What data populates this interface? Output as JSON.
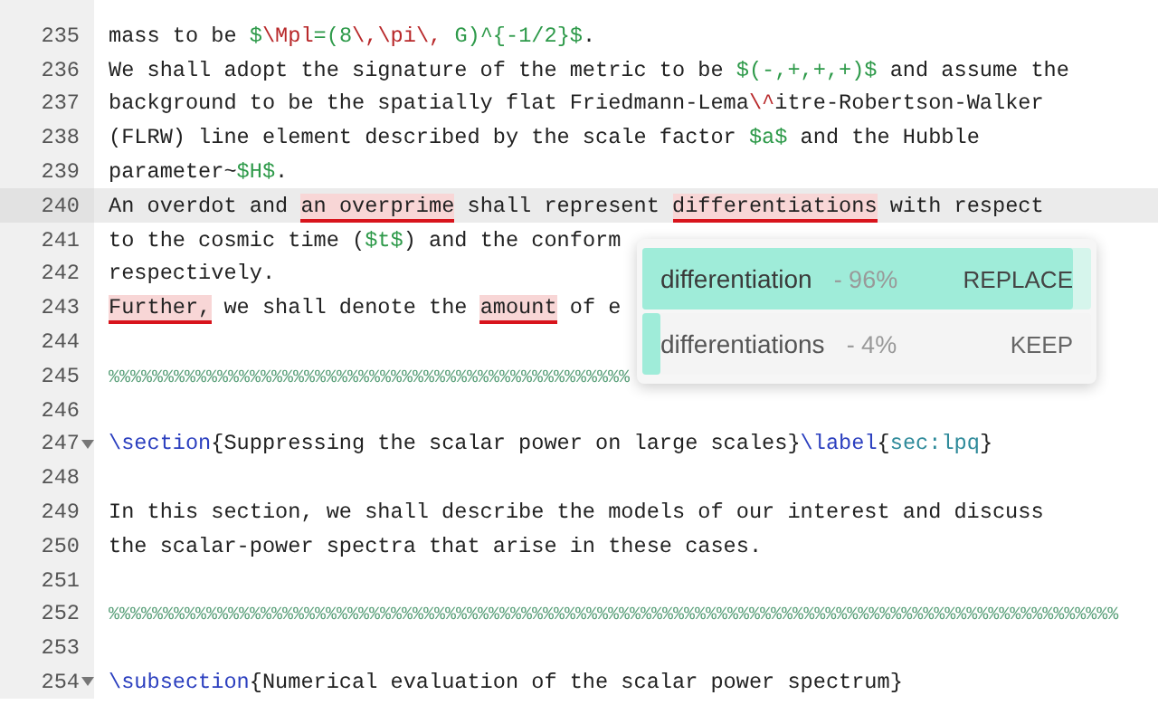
{
  "editor": {
    "lines": [
      {
        "number": "235",
        "current": false,
        "foldable": false,
        "segments": [
          {
            "kind": "plain",
            "text": "mass to be "
          },
          {
            "kind": "math",
            "text": "$"
          },
          {
            "kind": "mathcmd",
            "text": "\\Mpl"
          },
          {
            "kind": "math",
            "text": "=(8"
          },
          {
            "kind": "mathcmd",
            "text": "\\,\\pi\\,"
          },
          {
            "kind": "math",
            "text": " G)^{-1/2}$"
          },
          {
            "kind": "plain",
            "text": "."
          }
        ]
      },
      {
        "number": "236",
        "current": false,
        "foldable": false,
        "segments": [
          {
            "kind": "plain",
            "text": "We shall adopt the signature of the metric to be "
          },
          {
            "kind": "math",
            "text": "$(-,+,+,+)$"
          },
          {
            "kind": "plain",
            "text": " and assume the"
          }
        ]
      },
      {
        "number": "237",
        "current": false,
        "foldable": false,
        "segments": [
          {
            "kind": "plain",
            "text": "background to be the spatially flat Friedmann-Lema"
          },
          {
            "kind": "mathcmd",
            "text": "\\^"
          },
          {
            "kind": "plain",
            "text": "itre-Robertson-Walker"
          }
        ]
      },
      {
        "number": "238",
        "current": false,
        "foldable": false,
        "segments": [
          {
            "kind": "plain",
            "text": "(FLRW) line element described by the scale factor "
          },
          {
            "kind": "math",
            "text": "$a$"
          },
          {
            "kind": "plain",
            "text": " and the Hubble"
          }
        ]
      },
      {
        "number": "239",
        "current": false,
        "foldable": false,
        "segments": [
          {
            "kind": "plain",
            "text": "parameter~"
          },
          {
            "kind": "math",
            "text": "$H$"
          },
          {
            "kind": "plain",
            "text": "."
          }
        ]
      },
      {
        "number": "240",
        "current": true,
        "foldable": false,
        "segments": [
          {
            "kind": "plain",
            "text": "An overdot and "
          },
          {
            "kind": "error",
            "text": "an overprime"
          },
          {
            "kind": "plain",
            "text": " shall represent "
          },
          {
            "kind": "error",
            "text": "differentiations"
          },
          {
            "kind": "plain",
            "text": " with respect"
          }
        ]
      },
      {
        "number": "241",
        "current": false,
        "foldable": false,
        "segments": [
          {
            "kind": "plain",
            "text": "to the cosmic time ("
          },
          {
            "kind": "math",
            "text": "$t$"
          },
          {
            "kind": "plain",
            "text": ") and the conform"
          }
        ]
      },
      {
        "number": "242",
        "current": false,
        "foldable": false,
        "segments": [
          {
            "kind": "plain",
            "text": "respectively."
          }
        ]
      },
      {
        "number": "243",
        "current": false,
        "foldable": false,
        "segments": [
          {
            "kind": "error",
            "text": "Further,"
          },
          {
            "kind": "plain",
            "text": " we shall denote the "
          },
          {
            "kind": "error",
            "text": "amount"
          },
          {
            "kind": "plain",
            "text": " of e"
          }
        ]
      },
      {
        "number": "244",
        "current": false,
        "foldable": false
      },
      {
        "number": "245",
        "current": false,
        "foldable": false,
        "segments": [
          {
            "kind": "comment",
            "text": "%%%%%%%%%%%%%%%%%%%%%%%%%%%%%%%%%%%%%%%%%%%%%%%%"
          }
        ]
      },
      {
        "number": "246",
        "current": false,
        "foldable": false
      },
      {
        "number": "247",
        "current": false,
        "foldable": true,
        "segments": [
          {
            "kind": "command",
            "text": "\\section"
          },
          {
            "kind": "plain",
            "text": "{Suppressing the scalar power on large scales}"
          },
          {
            "kind": "command",
            "text": "\\label"
          },
          {
            "kind": "plain",
            "text": "{"
          },
          {
            "kind": "argument",
            "text": "sec:lpq"
          },
          {
            "kind": "plain",
            "text": "}"
          }
        ]
      },
      {
        "number": "248",
        "current": false,
        "foldable": false
      },
      {
        "number": "249",
        "current": false,
        "foldable": false,
        "segments": [
          {
            "kind": "plain",
            "text": "In this section, we shall describe the models of our interest and discuss"
          }
        ]
      },
      {
        "number": "250",
        "current": false,
        "foldable": false,
        "segments": [
          {
            "kind": "plain",
            "text": "the scalar-power spectra that arise in these cases."
          }
        ]
      },
      {
        "number": "251",
        "current": false,
        "foldable": false
      },
      {
        "number": "252",
        "current": false,
        "foldable": false,
        "segments": [
          {
            "kind": "comment",
            "text": "%%%%%%%%%%%%%%%%%%%%%%%%%%%%%%%%%%%%%%%%%%%%%%%%%%%%%%%%%%%%%%%%%%%%%%%%%%%%%%%%%%%%%%%%%%%%%"
          }
        ]
      },
      {
        "number": "253",
        "current": false,
        "foldable": false
      },
      {
        "number": "254",
        "current": false,
        "foldable": true,
        "segments": [
          {
            "kind": "command",
            "text": "\\subsection"
          },
          {
            "kind": "plain",
            "text": "{Numerical evaluation of the scalar power spectrum}"
          }
        ]
      }
    ]
  },
  "suggestions": [
    {
      "word": "differentiation",
      "confidence": "- 96%",
      "action": "REPLACE",
      "selected": true,
      "level": 0.96
    },
    {
      "word": "differentiations",
      "confidence": "- 4%",
      "action": "KEEP",
      "selected": false,
      "level": 0.04
    }
  ]
}
